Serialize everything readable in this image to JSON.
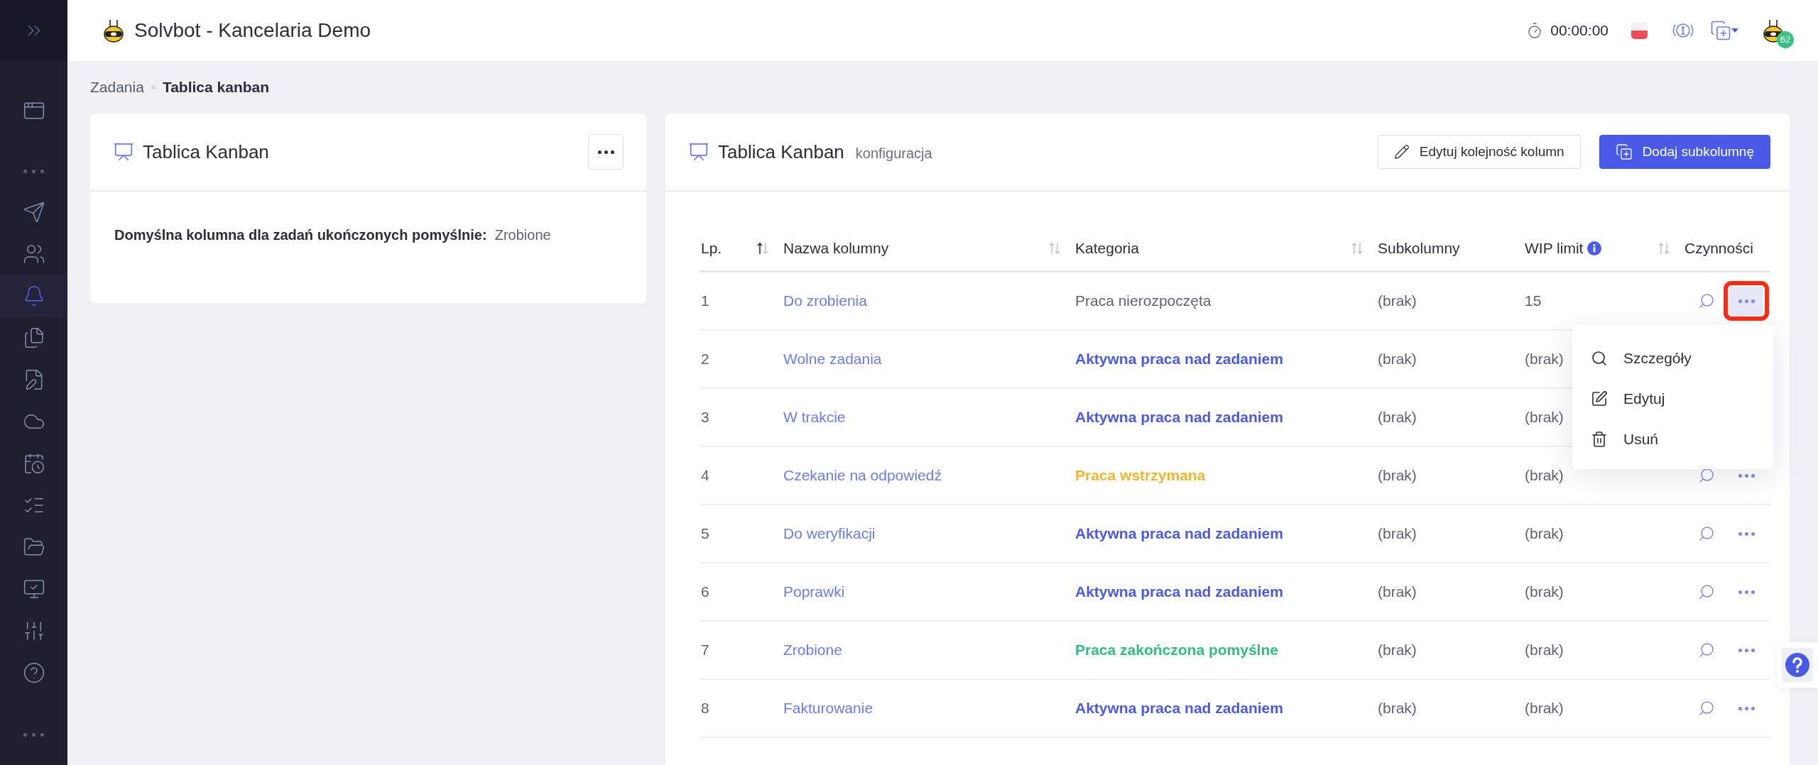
{
  "app": {
    "title": "Solvbot - Kancelaria Demo",
    "timer": "00:00:00",
    "notification_count": "62"
  },
  "sidebar": {
    "items": [
      {
        "selected": false
      },
      {
        "selected": false
      },
      {
        "selected": false
      },
      {
        "selected": true
      },
      {
        "selected": false
      },
      {
        "selected": false
      },
      {
        "selected": false
      },
      {
        "selected": false
      },
      {
        "selected": false
      },
      {
        "selected": false
      },
      {
        "selected": false
      },
      {
        "selected": false
      },
      {
        "selected": false
      }
    ]
  },
  "breadcrumb": [
    "Zadania",
    "Tablica kanban"
  ],
  "settings_card": {
    "title": "Tablica Kanban",
    "label": "Domyślna kolumna dla zadań ukończonych pomyślnie:",
    "value": "Zrobione"
  },
  "config_card": {
    "title": "Tablica Kanban",
    "subtitle": "konfiguracja",
    "buttons": [
      {
        "label": "Edytuj kolejność kolumn",
        "kind": "outline"
      },
      {
        "label": "Dodaj subkolumnę",
        "kind": "primary"
      }
    ]
  },
  "table": {
    "columns": [
      {
        "label": "Lp.",
        "sortable": true,
        "sorted": true,
        "info": false
      },
      {
        "label": "Nazwa kolumny",
        "sortable": true,
        "sorted": false,
        "info": false
      },
      {
        "label": "Kategoria",
        "sortable": true,
        "sorted": false,
        "info": false
      },
      {
        "label": "Subkolumny",
        "sortable": false,
        "info": false
      },
      {
        "label": "WIP limit",
        "sortable": true,
        "sorted": false,
        "info": true
      },
      {
        "label": "Czynności",
        "sortable": false,
        "info": false
      }
    ],
    "rows": [
      {
        "number": "1",
        "name": "Do zrobienia",
        "category": "Praca nierozpoczęta",
        "color": "#5f6275",
        "subcolumns": "(brak)",
        "wip": "15",
        "menu_open": true,
        "annotated": true
      },
      {
        "number": "2",
        "name": "Wolne zadania",
        "category": "Aktywna praca nad zadaniem",
        "color": "#4a5ae8",
        "subcolumns": "(brak)",
        "wip": "(brak)",
        "menu_open": false,
        "annotated": false
      },
      {
        "number": "3",
        "name": "W trakcie",
        "category": "Aktywna praca nad zadaniem",
        "color": "#4a5ae8",
        "subcolumns": "(brak)",
        "wip": "(brak)",
        "menu_open": false,
        "annotated": false
      },
      {
        "number": "4",
        "name": "Czekanie na odpowiedź",
        "category": "Praca wstrzymana",
        "color": "#f5b52a",
        "subcolumns": "(brak)",
        "wip": "(brak)",
        "menu_open": false,
        "annotated": false
      },
      {
        "number": "5",
        "name": "Do weryfikacji",
        "category": "Aktywna praca nad zadaniem",
        "color": "#4a5ae8",
        "subcolumns": "(brak)",
        "wip": "(brak)",
        "menu_open": false,
        "annotated": false
      },
      {
        "number": "6",
        "name": "Poprawki",
        "category": "Aktywna praca nad zadaniem",
        "color": "#4a5ae8",
        "subcolumns": "(brak)",
        "wip": "(brak)",
        "menu_open": false,
        "annotated": false
      },
      {
        "number": "7",
        "name": "Zrobione",
        "category": "Praca zakończona pomyślne",
        "color": "#2ec07f",
        "subcolumns": "(brak)",
        "wip": "(brak)",
        "menu_open": false,
        "annotated": false
      },
      {
        "number": "8",
        "name": "Fakturowanie",
        "category": "Aktywna praca nad zadaniem",
        "color": "#4a5ae8",
        "subcolumns": "(brak)",
        "wip": "(brak)",
        "menu_open": false,
        "annotated": false
      }
    ]
  },
  "row_menu": {
    "items": [
      {
        "label": "Szczegóły"
      },
      {
        "label": "Edytuj"
      },
      {
        "label": "Usuń"
      }
    ]
  }
}
